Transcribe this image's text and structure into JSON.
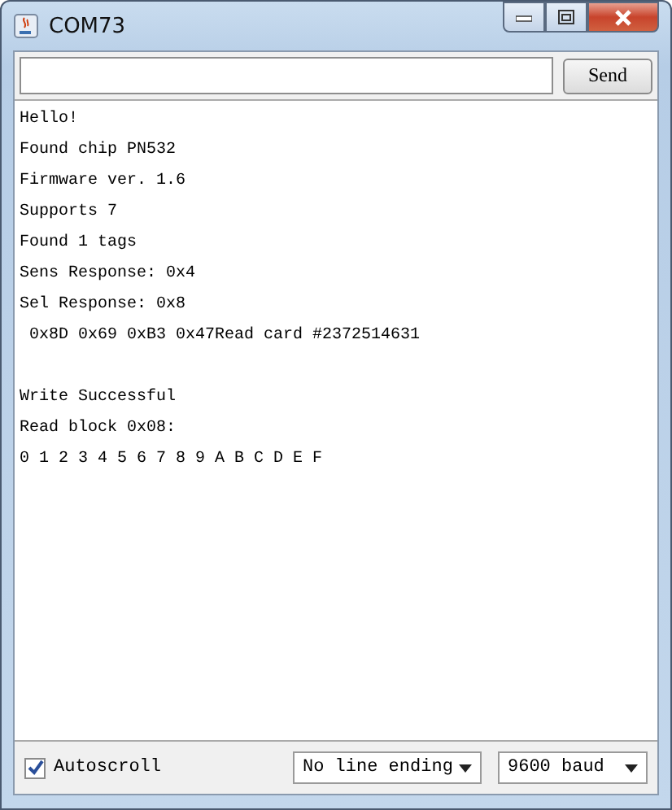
{
  "window": {
    "title": "COM73"
  },
  "input": {
    "send_label": "Send"
  },
  "console": {
    "blocks": [
      {
        "lines": [
          "Hello!",
          "Found chip PN532",
          "Firmware ver. 1.6",
          "Supports 7",
          "Found 1 tags",
          "Sens Response: 0x4",
          "Sel Response: 0x8",
          " 0x8D 0x69 0xB3 0x47Read card #2372514631"
        ]
      },
      {
        "lines": [
          "Write Successful",
          "Read block 0x08:",
          "0 1 2 3 4 5 6 7 8 9 A B C D E F"
        ]
      }
    ]
  },
  "footer": {
    "autoscroll": {
      "label": "Autoscroll",
      "checked": true
    },
    "line_ending": "No line ending",
    "baud": "9600 baud"
  }
}
